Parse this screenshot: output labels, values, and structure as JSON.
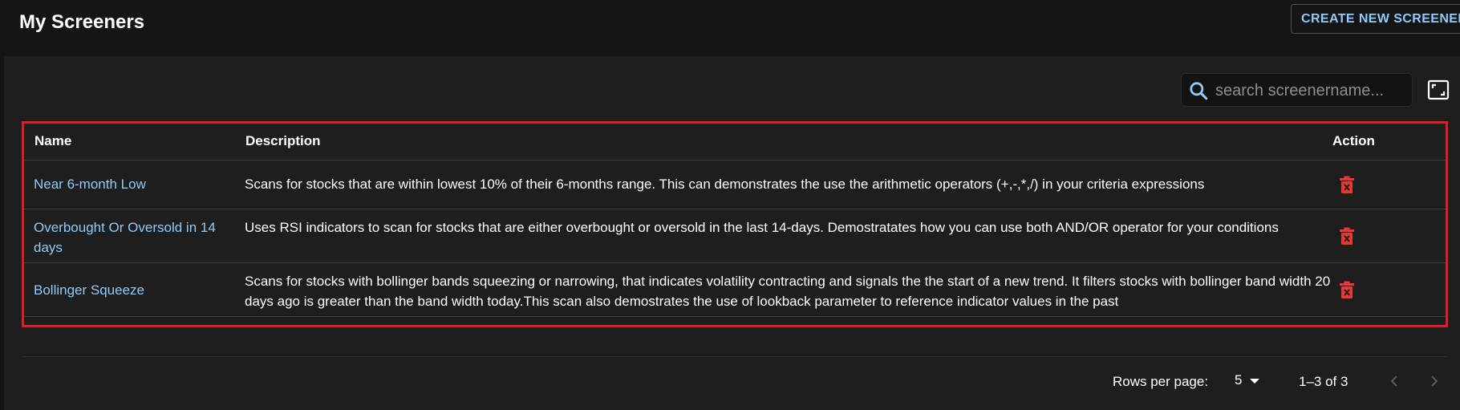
{
  "header": {
    "title": "My Screeners",
    "create_button": "CREATE NEW SCREENER"
  },
  "search": {
    "placeholder": "search screenername...",
    "value": ""
  },
  "table": {
    "columns": {
      "name": "Name",
      "description": "Description",
      "action": "Action"
    },
    "rows": [
      {
        "name": "Near 6-month Low",
        "description": "Scans for stocks that are within lowest 10% of their 6-months range. This can demonstrates the use the arithmetic operators (+,-,*,/) in your criteria expressions"
      },
      {
        "name": "Overbought Or Oversold in 14 days",
        "description": "Uses RSI indicators to scan for stocks that are either overbought or oversold in the last 14-days. Demostratates how you can use both AND/OR operator for your conditions"
      },
      {
        "name": "Bollinger Squeeze",
        "description": "Scans for stocks with bollinger bands squeezing or narrowing, that indicates volatility contracting and signals the the start of a new trend. It filters stocks with bollinger band width 20 days ago is greater than the band width today.This scan also demostrates the use of lookback parameter to reference indicator values in the past"
      }
    ]
  },
  "pagination": {
    "rows_per_page_label": "Rows per page:",
    "rows_per_page_value": "5",
    "range": "1–3 of 3"
  },
  "icons": {
    "search": "search-icon",
    "fullscreen": "fullscreen-icon",
    "delete": "delete-icon",
    "prev": "chevron-left-icon",
    "next": "chevron-right-icon",
    "dropdown": "caret-down-icon"
  },
  "colors": {
    "background": "#1e1e1e",
    "header": "#151515",
    "link": "#90caf9",
    "delete": "#e53935",
    "highlight_border": "#e21c24"
  }
}
